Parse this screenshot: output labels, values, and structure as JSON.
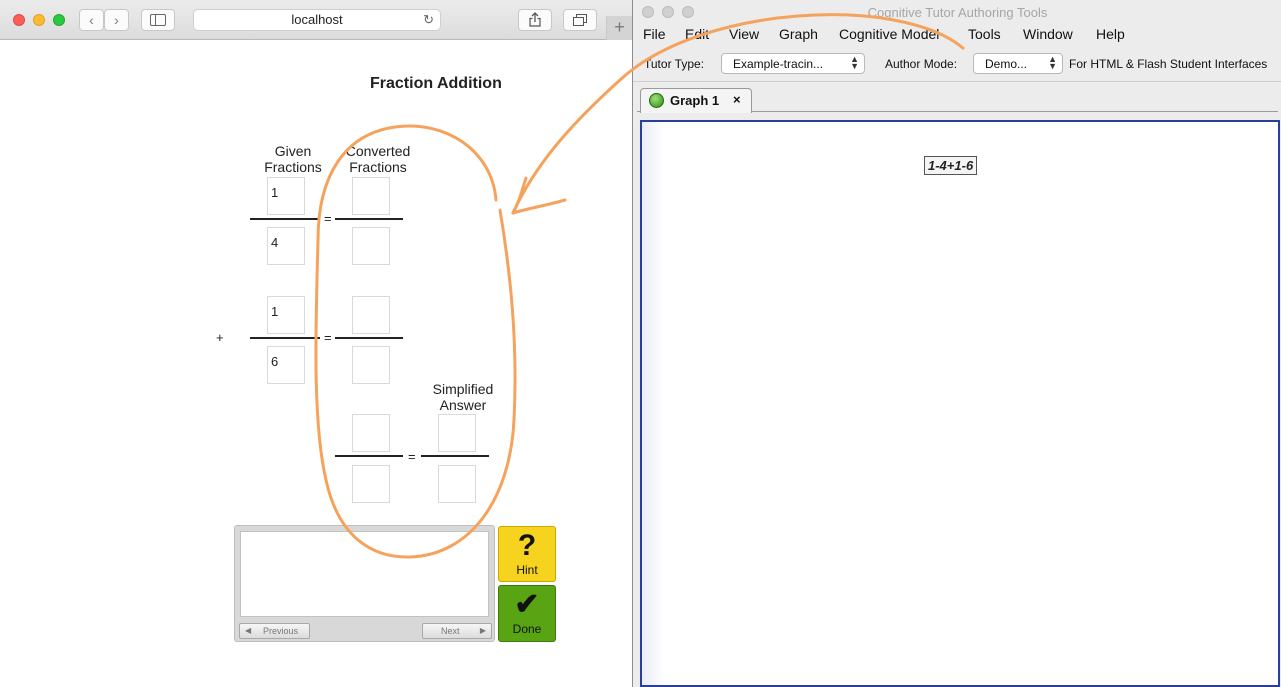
{
  "browser": {
    "address": "localhost",
    "new_tab": "+"
  },
  "tutor": {
    "title": "Fraction Addition",
    "headers": {
      "given": [
        "Given",
        "Fractions"
      ],
      "converted": [
        "Converted",
        "Fractions"
      ],
      "simplified": [
        "Simplified",
        "Answer"
      ]
    },
    "fraction1": {
      "numerator": "1",
      "denominator": "4"
    },
    "fraction2": {
      "numerator": "1",
      "denominator": "6"
    },
    "plus_sign": "+",
    "equals_sign": "=",
    "hint": {
      "glyph": "?",
      "label": "Hint",
      "color": "#f6d31e"
    },
    "done": {
      "glyph": "✔",
      "label": "Done",
      "color": "#58a413"
    },
    "message_nav": {
      "previous": "Previous",
      "next": "Next"
    }
  },
  "ctat": {
    "window_title": "Cognitive Tutor Authoring Tools",
    "menu": [
      "File",
      "Edit",
      "View",
      "Graph",
      "Cognitive Model",
      "Tools",
      "Window",
      "Help"
    ],
    "toolbar": {
      "tutor_type_label": "Tutor Type:",
      "tutor_type_value": "Example-tracin...",
      "author_mode_label": "Author Mode:",
      "author_mode_value": "Demo...",
      "interface_note": "For HTML & Flash Student Interfaces"
    },
    "tab": {
      "label": "Graph 1",
      "close": "×"
    },
    "start_state": "1-4+1-6"
  },
  "annotation": {
    "color": "#f5a35c"
  }
}
